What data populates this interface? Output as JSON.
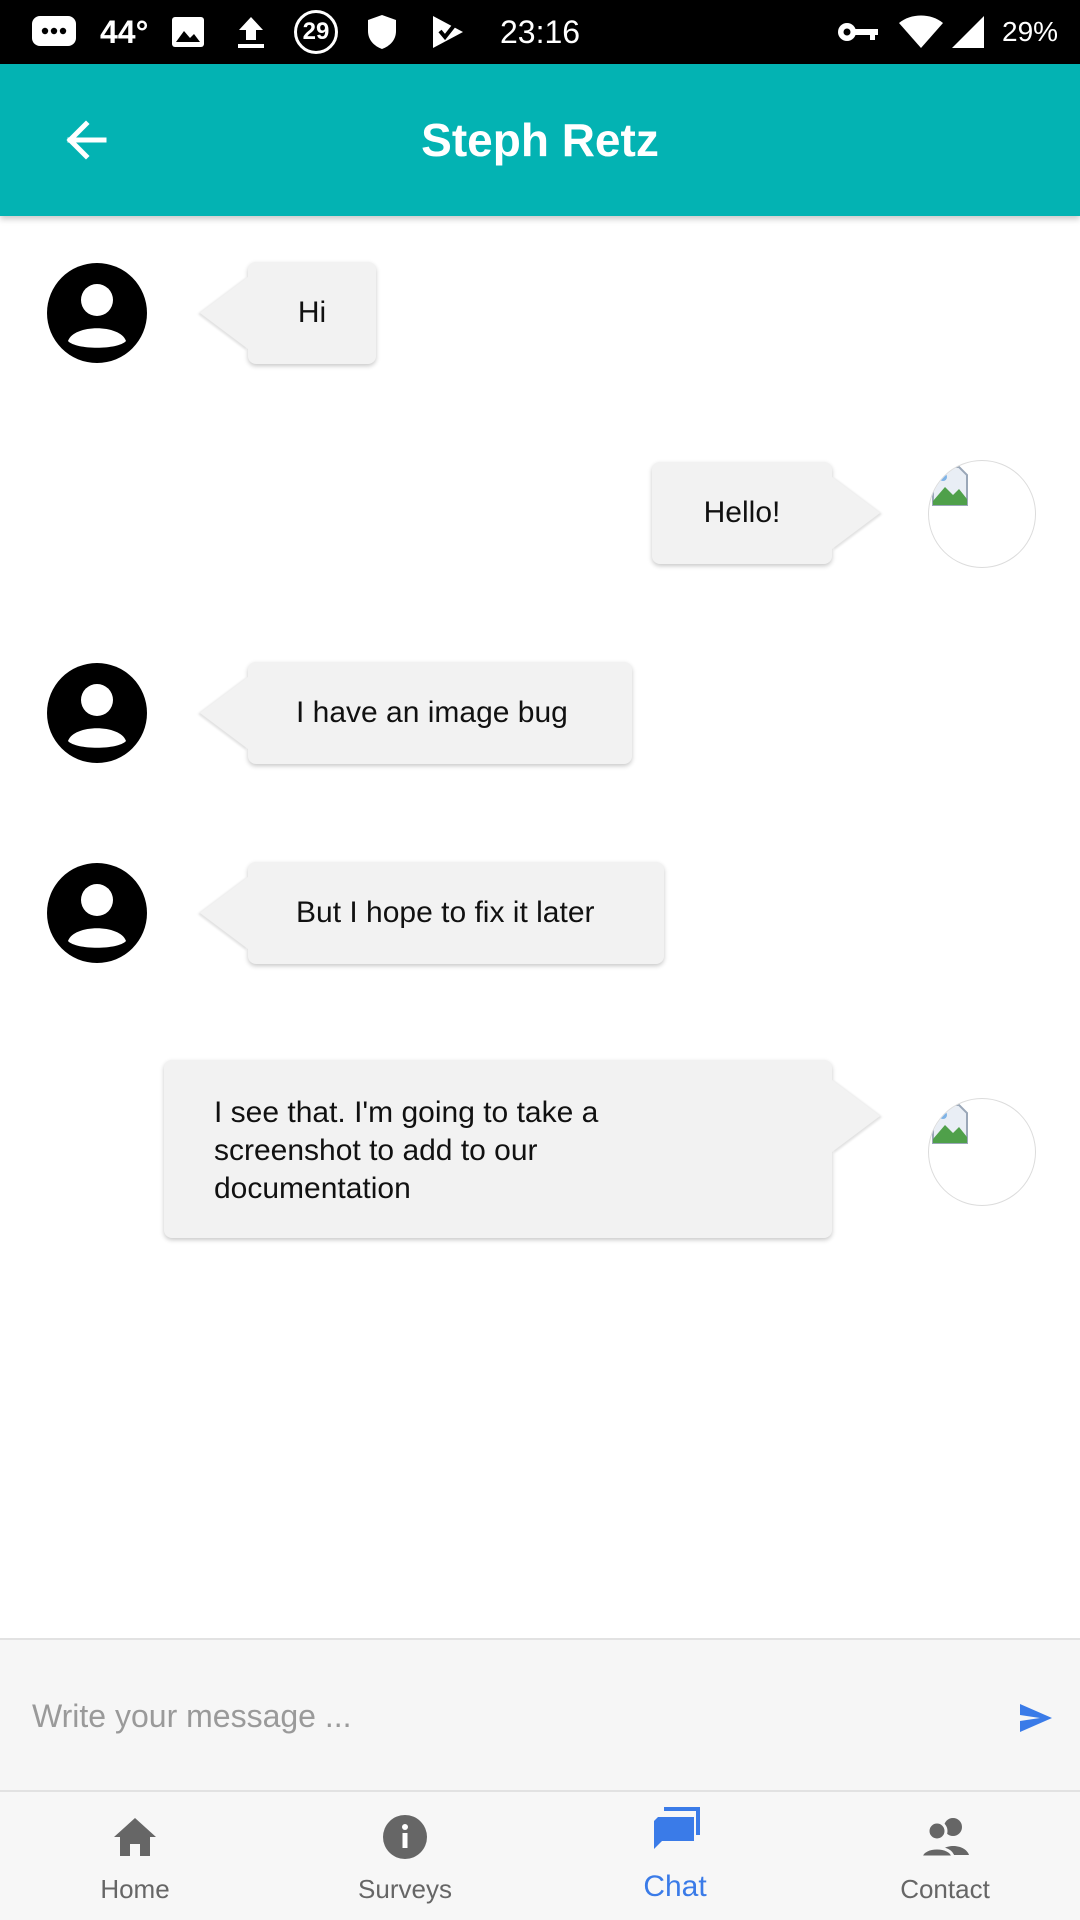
{
  "status_bar": {
    "temperature": "44°",
    "notification_count": "29",
    "time": "23:16",
    "battery": "29%"
  },
  "header": {
    "title": "Steph Retz",
    "back_icon": "arrow-back-icon",
    "background_color": "#03b3b3"
  },
  "messages": [
    {
      "side": "received",
      "text": "Hi"
    },
    {
      "side": "sent",
      "text": "Hello!"
    },
    {
      "side": "received",
      "text": "I have an image bug"
    },
    {
      "side": "received",
      "text": "But I hope to fix it later"
    },
    {
      "side": "sent",
      "text_lines": [
        "I see that. I'm going to take a",
        "screenshot to add to our",
        "documentation"
      ]
    }
  ],
  "composer": {
    "placeholder": "Write your message ...",
    "send_icon": "send-icon",
    "send_color": "#3a7be8"
  },
  "bottom_nav": {
    "active": "Chat",
    "active_color": "#3a7be8",
    "items": [
      {
        "label": "Home",
        "icon": "home-icon"
      },
      {
        "label": "Surveys",
        "icon": "info-icon"
      },
      {
        "label": "Chat",
        "icon": "chat-icon"
      },
      {
        "label": "Contact",
        "icon": "contacts-icon"
      }
    ]
  }
}
